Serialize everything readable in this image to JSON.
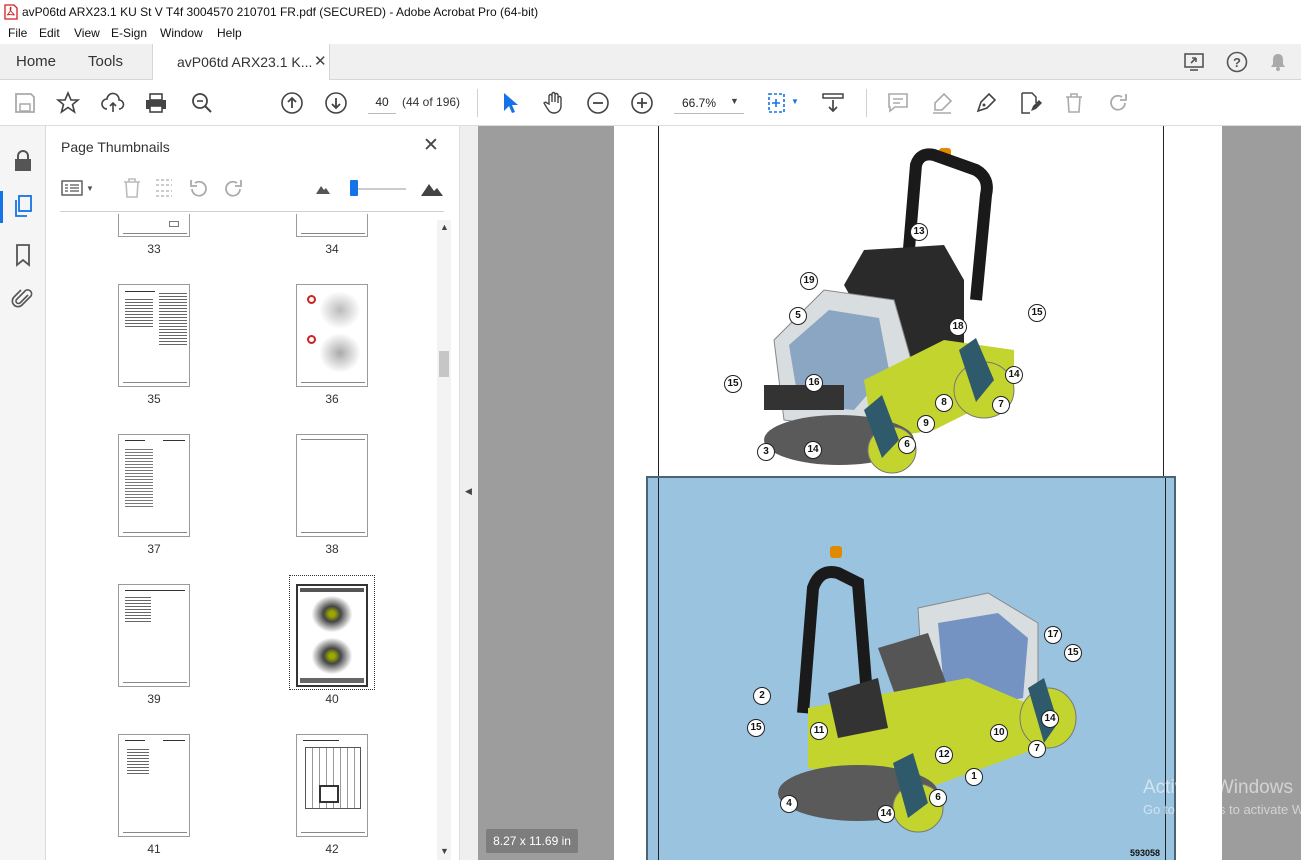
{
  "window": {
    "title": "avP06td ARX23.1 KU St V T4f 3004570 210701 FR.pdf (SECURED) - Adobe Acrobat Pro (64-bit)"
  },
  "menu": [
    "File",
    "Edit",
    "View",
    "E-Sign",
    "Window",
    "Help"
  ],
  "tabs": {
    "home": "Home",
    "tools": "Tools",
    "document": "avP06td ARX23.1 K..."
  },
  "toolbar": {
    "page_input": "40",
    "page_count": "(44 of 196)",
    "zoom": "66.7%"
  },
  "panel": {
    "title": "Page Thumbnails"
  },
  "thumbnails": [
    "33",
    "34",
    "35",
    "36",
    "37",
    "38",
    "39",
    "40",
    "41",
    "42"
  ],
  "status": {
    "page_size": "8.27 x 11.69 in"
  },
  "document": {
    "fig_top_callouts": [
      "13",
      "19",
      "5",
      "18",
      "15",
      "15",
      "16",
      "14",
      "8",
      "7",
      "9",
      "3",
      "14",
      "6"
    ],
    "fig_bottom_callouts": [
      "17",
      "15",
      "2",
      "11",
      "15",
      "10",
      "14",
      "12",
      "7",
      "1",
      "6",
      "4",
      "14"
    ],
    "figure_code": "593058"
  },
  "watermark": {
    "line1": "Activate Windows",
    "line2": "Go to Settings to activate Windows."
  },
  "colors": {
    "accent": "#1473e6",
    "selection_blue": "#9ac3df",
    "machine_green": "#c4d42e"
  }
}
